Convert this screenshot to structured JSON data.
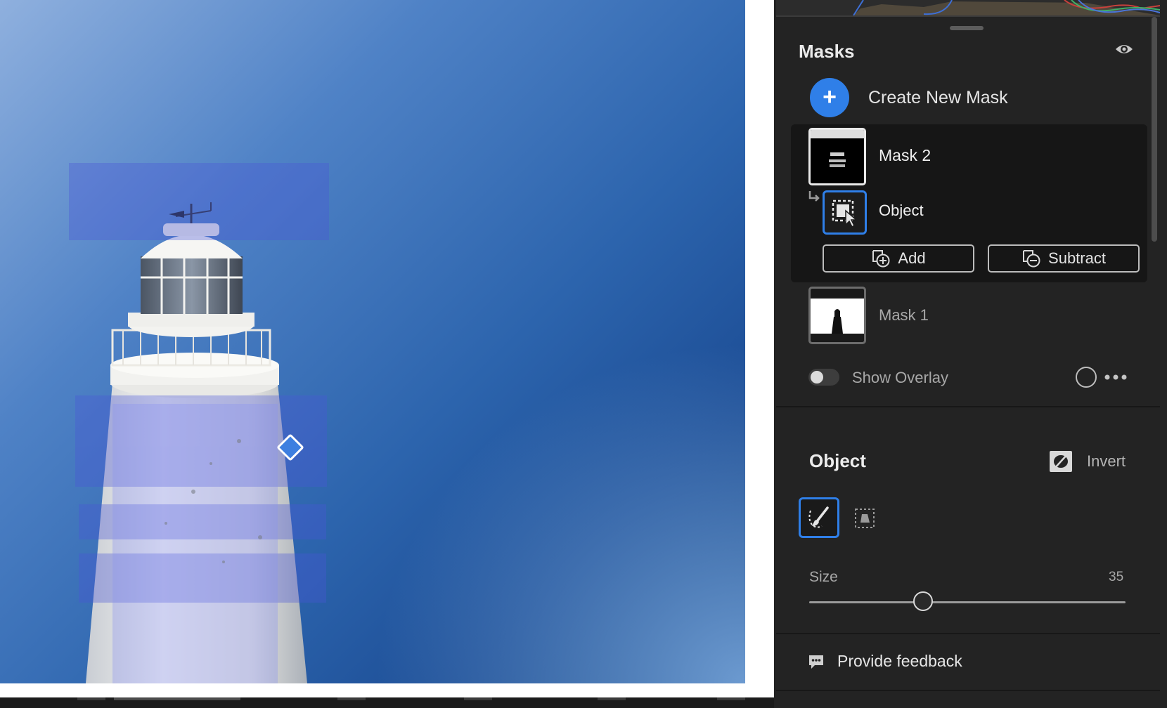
{
  "panel": {
    "title": "Masks",
    "create_new_mask": "Create New Mask",
    "masks": [
      {
        "name": "Mask 2",
        "selected": true,
        "components": [
          {
            "label": "Object"
          }
        ]
      },
      {
        "name": "Mask 1",
        "selected": false
      }
    ],
    "add_label": "Add",
    "subtract_label": "Subtract",
    "show_overlay": "Show Overlay",
    "show_overlay_enabled": false
  },
  "object_settings": {
    "title": "Object",
    "invert_label": "Invert",
    "tools": [
      "brush-select-icon",
      "rectangle-select-icon"
    ],
    "size_label": "Size",
    "size_value": "35",
    "size_fraction": 0.36
  },
  "feedback": {
    "label": "Provide feedback"
  },
  "icons": {
    "eye": "eye-icon",
    "plus": "plus-icon",
    "more": "more-icon",
    "feedback": "chat-bubble-icon",
    "invert": "invert-icon"
  },
  "colors": {
    "accent": "#2f7fe8",
    "panel_bg": "#232323",
    "mask_overlay": "#4a56d8"
  }
}
